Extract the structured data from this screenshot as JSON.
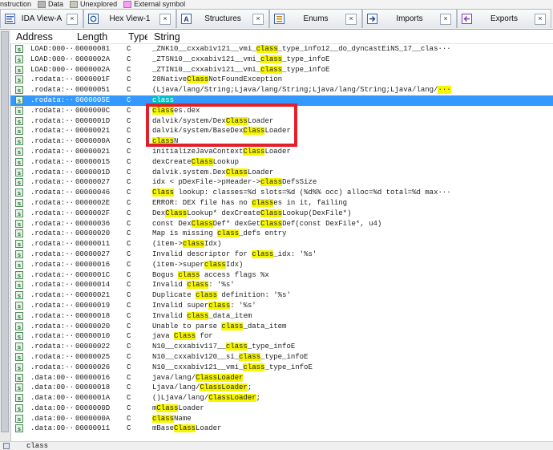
{
  "legend": {
    "items": [
      {
        "label": "nstruction",
        "color": ""
      },
      {
        "label": "Data",
        "color": "#b4b4b4"
      },
      {
        "label": "Unexplored",
        "color": "#c8c8b4"
      },
      {
        "label": "External symbol",
        "color": "#ff99ff"
      }
    ]
  },
  "tabs": [
    {
      "label": "IDA View-A",
      "icon": "ida-view-icon",
      "width": 104
    },
    {
      "label": "Hex View-1",
      "icon": "hex-view-icon",
      "width": 116
    },
    {
      "label": "Structures",
      "icon": "structures-icon",
      "width": 116
    },
    {
      "label": "Enums",
      "icon": "enums-icon",
      "width": 116
    },
    {
      "label": "Imports",
      "icon": "imports-icon",
      "width": 118
    },
    {
      "label": "Exports",
      "icon": "exports-icon",
      "width": 118
    }
  ],
  "columns": {
    "address": "Address",
    "length": "Length",
    "type": "Type",
    "string": "String"
  },
  "rows": [
    {
      "a": "LOAD:000···",
      "l": "00000081",
      "t": "C",
      "s": "_ZNK10__cxxabiv121__vmi_[class]_type_info12__do_dyncastEiNS_17__clas···"
    },
    {
      "a": "LOAD:000···",
      "l": "0000002A",
      "t": "C",
      "s": "_ZTSN10__cxxabiv121__vmi_[class]_type_infoE"
    },
    {
      "a": "LOAD:000···",
      "l": "0000002A",
      "t": "C",
      "s": "_ZTIN10__cxxabiv121__vmi_[class]_type_infoE"
    },
    {
      "a": ".rodata:···",
      "l": "0000001F",
      "t": "C",
      "s": "28Native[Class]NotFoundException"
    },
    {
      "a": ".rodata:···",
      "l": "00000051",
      "t": "C",
      "s": "(Ljava/lang/String;Ljava/lang/String;Ljava/lang/String;Ljava/lang/[···]"
    },
    {
      "a": ".rodata:···",
      "l": "0000005E",
      "t": "C",
      "s": "[class]",
      "selected": true
    },
    {
      "a": ".rodata:···",
      "l": "0000000C",
      "t": "C",
      "s": "[class]es.dex"
    },
    {
      "a": ".rodata:···",
      "l": "0000001D",
      "t": "C",
      "s": "dalvik/system/Dex[Class]Loader"
    },
    {
      "a": ".rodata:···",
      "l": "00000021",
      "t": "C",
      "s": "dalvik/system/BaseDex[Class]Loader"
    },
    {
      "a": ".rodata:···",
      "l": "0000000A",
      "t": "C",
      "s": "[class]N"
    },
    {
      "a": ".rodata:···",
      "l": "00000021",
      "t": "C",
      "s": "initializeJavaContext[Class]Loader"
    },
    {
      "a": ".rodata:···",
      "l": "00000015",
      "t": "C",
      "s": "dexCreate[Class]Lookup"
    },
    {
      "a": ".rodata:···",
      "l": "0000001D",
      "t": "C",
      "s": "dalvik.system.Dex[Class]Loader"
    },
    {
      "a": ".rodata:···",
      "l": "00000027",
      "t": "C",
      "s": "idx < pDexFile->pHeader->[class]DefsSize"
    },
    {
      "a": ".rodata:···",
      "l": "00000046",
      "t": "C",
      "s": "[Class] lookup: classes=%d slots=%d (%d%% occ) alloc=%d total=%d max···"
    },
    {
      "a": ".rodata:···",
      "l": "0000002E",
      "t": "C",
      "s": "ERROR: DEX file has no [class]es in it, failing"
    },
    {
      "a": ".rodata:···",
      "l": "0000002F",
      "t": "C",
      "s": "Dex[Class]Lookup* dexCreate[Class]Lookup(DexFile*)"
    },
    {
      "a": ".rodata:···",
      "l": "00000036",
      "t": "C",
      "s": "const Dex[Class]Def* dexGet[Class]Def(const DexFile*, u4)"
    },
    {
      "a": ".rodata:···",
      "l": "00000020",
      "t": "C",
      "s": "Map is missing [class]_defs entry"
    },
    {
      "a": ".rodata:···",
      "l": "00000011",
      "t": "C",
      "s": "(item->[class]Idx)"
    },
    {
      "a": ".rodata:···",
      "l": "00000027",
      "t": "C",
      "s": "Invalid descriptor for [class]_idx: '%s'"
    },
    {
      "a": ".rodata:···",
      "l": "00000016",
      "t": "C",
      "s": "(item->super[class]Idx)"
    },
    {
      "a": ".rodata:···",
      "l": "0000001C",
      "t": "C",
      "s": "Bogus [class] access flags %x"
    },
    {
      "a": ".rodata:···",
      "l": "00000014",
      "t": "C",
      "s": "Invalid [class]: '%s'"
    },
    {
      "a": ".rodata:···",
      "l": "00000021",
      "t": "C",
      "s": "Duplicate [class] definition: '%s'"
    },
    {
      "a": ".rodata:···",
      "l": "00000019",
      "t": "C",
      "s": "Invalid super[class]: '%s'"
    },
    {
      "a": ".rodata:···",
      "l": "00000018",
      "t": "C",
      "s": "Invalid [class]_data_item"
    },
    {
      "a": ".rodata:···",
      "l": "00000020",
      "t": "C",
      "s": "Unable to parse [class]_data_item"
    },
    {
      "a": ".rodata:···",
      "l": "00000010",
      "t": "C",
      "s": "java [Class] for"
    },
    {
      "a": ".rodata:···",
      "l": "00000022",
      "t": "C",
      "s": "N10__cxxabiv117__[class]_type_infoE"
    },
    {
      "a": ".rodata:···",
      "l": "00000025",
      "t": "C",
      "s": "N10__cxxabiv120__si_[class]_type_infoE"
    },
    {
      "a": ".rodata:···",
      "l": "00000026",
      "t": "C",
      "s": "N10__cxxabiv121__vmi_[class]_type_infoE"
    },
    {
      "a": ".data:00···",
      "l": "00000016",
      "t": "C",
      "s": "java/lang/[ClassLoader]"
    },
    {
      "a": ".data:00···",
      "l": "00000018",
      "t": "C",
      "s": "Ljava/lang/[ClassLoader];"
    },
    {
      "a": ".data:00···",
      "l": "0000001A",
      "t": "C",
      "s": "()Ljava/lang/[ClassLoader];"
    },
    {
      "a": ".data:00···",
      "l": "0000000D",
      "t": "C",
      "s": "m[Class]Loader"
    },
    {
      "a": ".data:00···",
      "l": "0000000A",
      "t": "C",
      "s": "[class]Name"
    },
    {
      "a": ".data:00···",
      "l": "00000011",
      "t": "C",
      "s": "mBase[Class]Loader"
    }
  ],
  "status": {
    "text": "class"
  },
  "colors": {
    "highlight": "#f6f600",
    "selection": "#3399ff",
    "annotation": "#e3202a"
  }
}
